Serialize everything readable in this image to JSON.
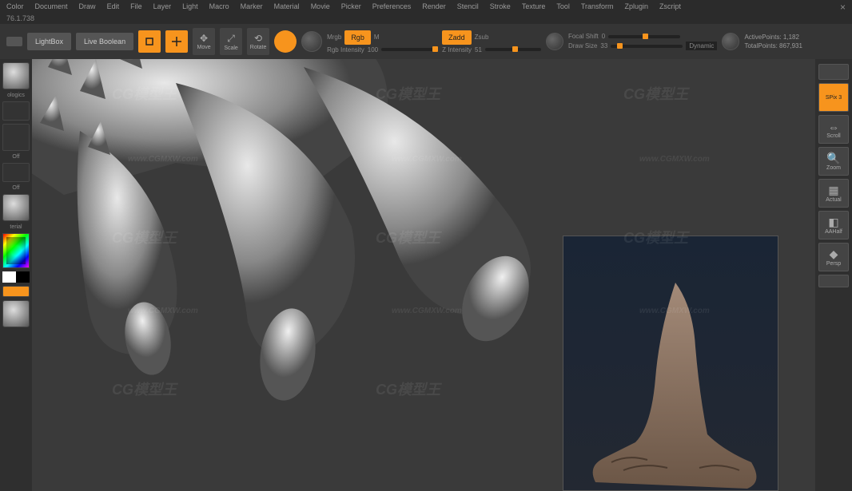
{
  "menu": [
    "Color",
    "Document",
    "Draw",
    "Edit",
    "File",
    "Layer",
    "Light",
    "Macro",
    "Marker",
    "Material",
    "Movie",
    "Picker",
    "Preferences",
    "Render",
    "Stencil",
    "Stroke",
    "Texture",
    "Tool",
    "Transform",
    "Zplugin",
    "Zscript"
  ],
  "version": "76.1.738",
  "buttons": {
    "lightbox": "LightBox",
    "liveboolean": "Live Boolean",
    "edit": "Edit",
    "draw": "Draw",
    "move": "Move",
    "scale": "Scale",
    "rotate": "Rotate"
  },
  "mode": {
    "mrgb": "Mrgb",
    "rgb": "Rgb",
    "m": "M",
    "zadd": "Zadd",
    "zsub": "Zsub"
  },
  "sliders": {
    "rgbIntensity": {
      "label": "Rgb Intensity",
      "value": "100"
    },
    "zIntensity": {
      "label": "Z Intensity",
      "value": "51"
    },
    "focalShift": {
      "label": "Focal Shift",
      "value": "0"
    },
    "drawSize": {
      "label": "Draw Size",
      "value": "33"
    }
  },
  "stats": {
    "active": {
      "label": "ActivePoints:",
      "value": "1,182"
    },
    "total": {
      "label": "TotalPoints:",
      "value": "867,931"
    }
  },
  "leftPanel": {
    "ologics": "ologics",
    "off1": "Off",
    "off2": "Off",
    "terial": "terial"
  },
  "rightTools": {
    "spix": "SPix 3",
    "scroll": "Scroll",
    "zoom": "Zoom",
    "actual": "Actual",
    "aahalf": "AAHalf",
    "persp": "Persp"
  },
  "dynamic": "Dynamic",
  "watermarks": [
    "CG模型王",
    "www.CGMXW.com"
  ]
}
